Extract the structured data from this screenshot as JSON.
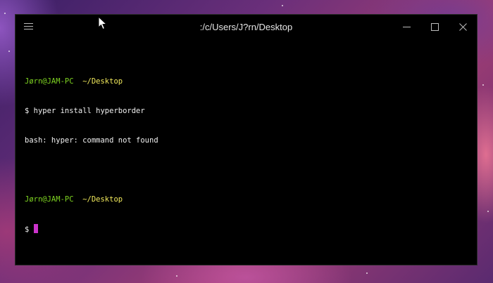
{
  "window": {
    "title": ":/c/Users/J?rn/Desktop",
    "controls": [
      "minimize-icon",
      "maximize-icon",
      "close-icon"
    ],
    "menu_icon": "hamburger-icon"
  },
  "terminal": {
    "lines": [
      {
        "user": "Jørn@JAM-PC",
        "cwd": "~/Desktop"
      },
      {
        "prompt": "$",
        "command": "hyper install hyperborder"
      },
      {
        "output": "bash: hyper: command not found"
      },
      {
        "user": "Jørn@JAM-PC",
        "cwd": "~/Desktop"
      },
      {
        "prompt": "$"
      }
    ]
  },
  "colors": {
    "user": "#7ed321",
    "cwd": "#f2ea5c",
    "cursor": "#cc33cc",
    "background": "#000000"
  }
}
